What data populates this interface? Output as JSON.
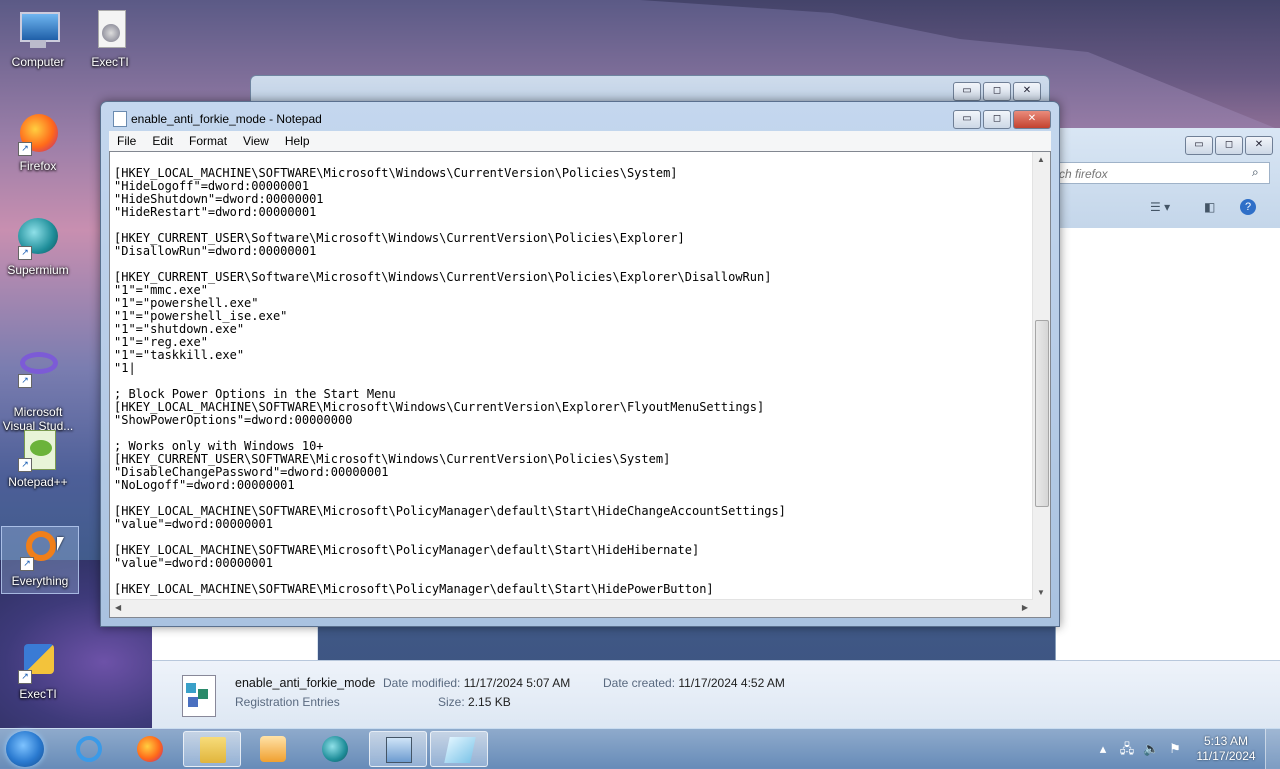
{
  "desktop": {
    "icons": [
      {
        "label": "Computer",
        "icon": "computer-icon"
      },
      {
        "label": "ExecTI",
        "icon": "exec-ti-icon"
      },
      {
        "label": "Firefox",
        "icon": "firefox-icon"
      },
      {
        "label": "Supermium",
        "icon": "supermium-icon"
      },
      {
        "label": "Microsoft\nVisual Stud...",
        "icon": "visual-studio-icon"
      },
      {
        "label": "Notepad++",
        "icon": "notepadpp-icon"
      },
      {
        "label": "Everything",
        "icon": "everything-icon"
      },
      {
        "label": "ExecTI",
        "icon": "exec-ti-shield-icon"
      }
    ]
  },
  "explorer": {
    "search_placeholder": "ch firefox",
    "details": {
      "filename": "enable_anti_forkie_mode",
      "filetype": "Registration Entries",
      "date_modified_label": "Date modified:",
      "date_modified": "11/17/2024 5:07 AM",
      "date_created_label": "Date created:",
      "date_created": "11/17/2024 4:52 AM",
      "size_label": "Size:",
      "size": "2.15 KB"
    }
  },
  "notepad": {
    "title": "enable_anti_forkie_mode - Notepad",
    "menu": [
      "File",
      "Edit",
      "Format",
      "View",
      "Help"
    ],
    "lines": [
      "",
      "[HKEY_LOCAL_MACHINE\\SOFTWARE\\Microsoft\\Windows\\CurrentVersion\\Policies\\System]",
      "\"HideLogoff\"=dword:00000001",
      "\"HideShutdown\"=dword:00000001",
      "\"HideRestart\"=dword:00000001",
      "",
      "[HKEY_CURRENT_USER\\Software\\Microsoft\\Windows\\CurrentVersion\\Policies\\Explorer]",
      "\"DisallowRun\"=dword:00000001",
      "",
      "[HKEY_CURRENT_USER\\Software\\Microsoft\\Windows\\CurrentVersion\\Policies\\Explorer\\DisallowRun]",
      "\"1\"=\"mmc.exe\"",
      "\"1\"=\"powershell.exe\"",
      "\"1\"=\"powershell_ise.exe\"",
      "\"1\"=\"shutdown.exe\"",
      "\"1\"=\"reg.exe\"",
      "\"1\"=\"taskkill.exe\"",
      "\"1|",
      "",
      "; Block Power Options in the Start Menu",
      "[HKEY_LOCAL_MACHINE\\SOFTWARE\\Microsoft\\Windows\\CurrentVersion\\Explorer\\FlyoutMenuSettings]",
      "\"ShowPowerOptions\"=dword:00000000",
      "",
      "; Works only with Windows 10+",
      "[HKEY_CURRENT_USER\\SOFTWARE\\Microsoft\\Windows\\CurrentVersion\\Policies\\System]",
      "\"DisableChangePassword\"=dword:00000001",
      "\"NoLogoff\"=dword:00000001",
      "",
      "[HKEY_LOCAL_MACHINE\\SOFTWARE\\Microsoft\\PolicyManager\\default\\Start\\HideChangeAccountSettings]",
      "\"value\"=dword:00000001",
      "",
      "[HKEY_LOCAL_MACHINE\\SOFTWARE\\Microsoft\\PolicyManager\\default\\Start\\HideHibernate]",
      "\"value\"=dword:00000001",
      "",
      "[HKEY_LOCAL_MACHINE\\SOFTWARE\\Microsoft\\PolicyManager\\default\\Start\\HidePowerButton]"
    ]
  },
  "taskbar": {
    "apps": [
      "internet-explorer-icon",
      "firefox-icon",
      "file-explorer-icon",
      "media-player-icon",
      "supermium-icon",
      "control-panel-icon",
      "notepad-icon"
    ],
    "clock_time": "5:13 AM",
    "clock_date": "11/17/2024"
  }
}
